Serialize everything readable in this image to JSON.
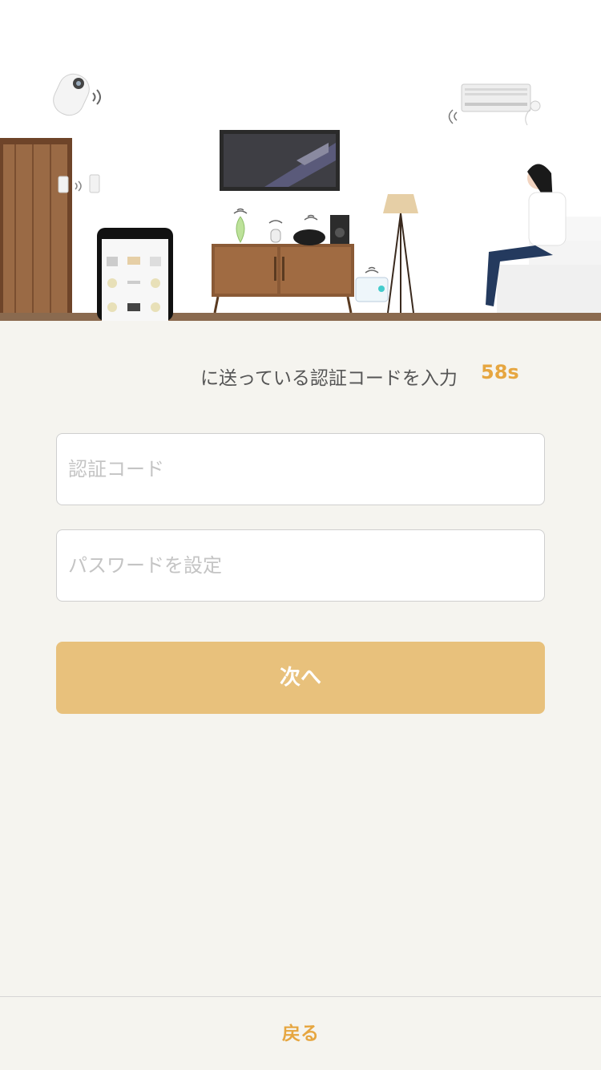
{
  "instruction": {
    "message": "に送っている認証コードを入力",
    "countdown": "58s"
  },
  "form": {
    "code_placeholder": "認証コード",
    "password_placeholder": "パスワードを設定",
    "next_label": "次へ"
  },
  "footer": {
    "back_label": "戻る"
  },
  "colors": {
    "accent": "#e6a640",
    "button": "#e8c17c",
    "background": "#f5f4ef"
  }
}
